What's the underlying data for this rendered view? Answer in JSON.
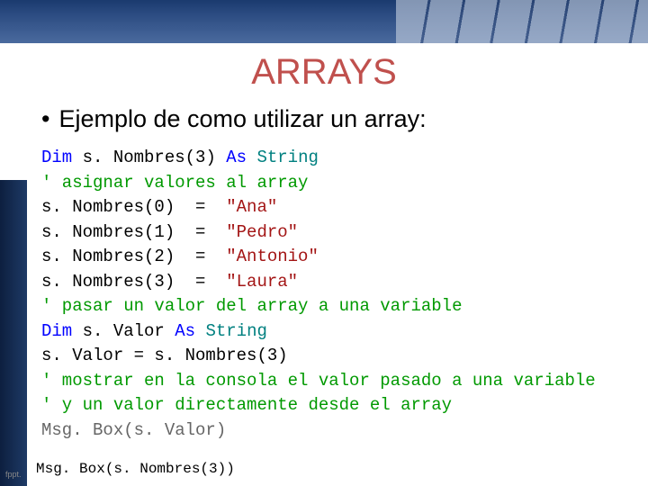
{
  "title": "ARRAYS",
  "bullet": "Ejemplo de como utilizar un array:",
  "code": {
    "l1": {
      "dim": "Dim",
      "var": " s. Nombres",
      "paren": "(3) ",
      "as": "As ",
      "type": "String"
    },
    "l2": "' asignar valores al array",
    "l3": {
      "lhs": "s. Nombres(0)  =  ",
      "rhs": "\"Ana\""
    },
    "l4": {
      "lhs": "s. Nombres(1)  =  ",
      "rhs": "\"Pedro\""
    },
    "l5": {
      "lhs": "s. Nombres(2)  =  ",
      "rhs": "\"Antonio\""
    },
    "l6": {
      "lhs": "s. Nombres(3)  =  ",
      "rhs": "\"Laura\""
    },
    "l7": "' pasar un valor del array a una variable",
    "l8": {
      "dim": "Dim",
      "var": " s. Valor ",
      "as": "As ",
      "type": "String"
    },
    "l9": "s. Valor = s. Nombres(3)",
    "l10": "' mostrar en la consola el valor pasado a una variable",
    "l11": "' y un valor directamente desde el array",
    "l12": "Msg. Box(s. Valor)"
  },
  "last": "Msg. Box(s. Nombres(3))",
  "url": "fppt."
}
